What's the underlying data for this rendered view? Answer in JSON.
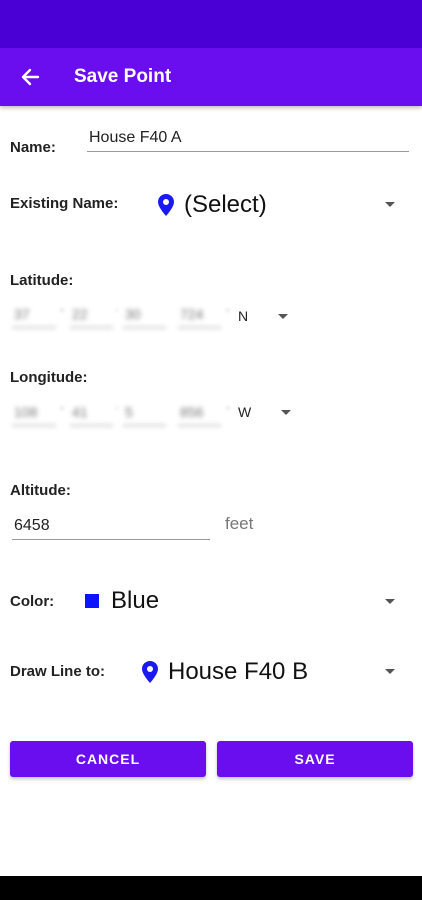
{
  "app_bar": {
    "title": "Save Point",
    "back_icon": "arrow-back-icon"
  },
  "form": {
    "name_label": "Name:",
    "name_value": "House F40 A",
    "existing_name_label": "Existing Name:",
    "existing_name_value": "(Select)",
    "latitude_label": "Latitude:",
    "latitude": {
      "deg": "37",
      "min": "22",
      "sec": "30",
      "frac": "724",
      "hemisphere": "N"
    },
    "longitude_label": "Longitude:",
    "longitude": {
      "deg": "108",
      "min": "41",
      "sec": "5",
      "frac": "856",
      "hemisphere": "W"
    },
    "altitude_label": "Altitude:",
    "altitude_value": "6458",
    "altitude_unit": "feet",
    "color_label": "Color:",
    "color_value": "Blue",
    "color_hex": "#0a14ff",
    "draw_line_label": "Draw Line to:",
    "draw_line_value": "House F40 B"
  },
  "buttons": {
    "cancel": "CANCEL",
    "save": "SAVE"
  },
  "theme": {
    "primary": "#6a0ef0",
    "status_bar": "#4a00d4",
    "pin_color": "#1a1af0"
  }
}
